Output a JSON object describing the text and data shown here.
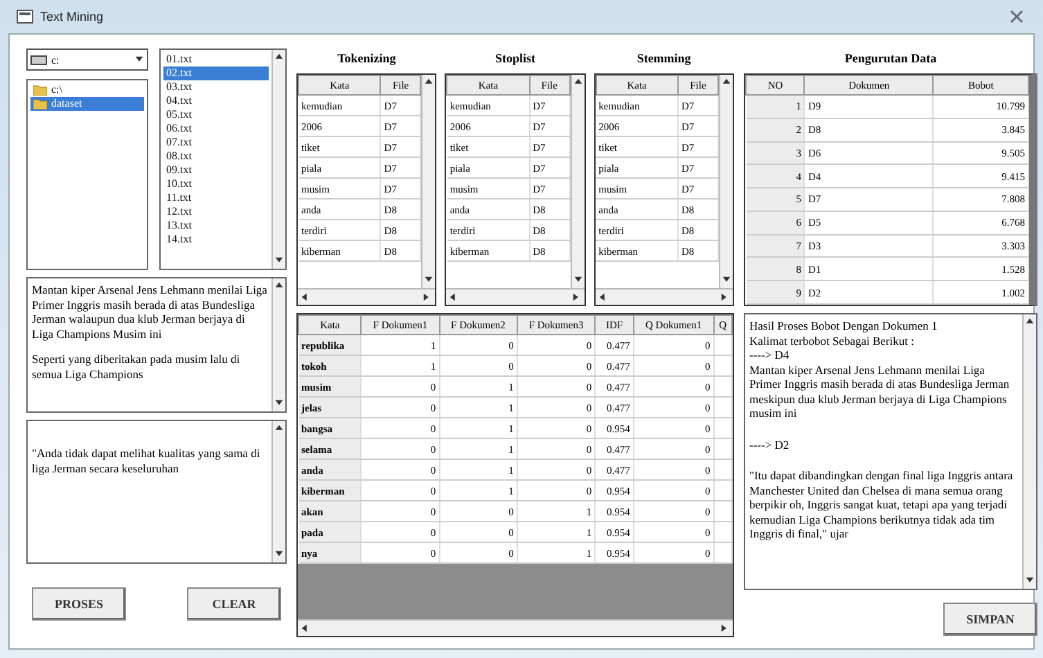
{
  "window": {
    "title": "Text Mining"
  },
  "browser": {
    "drive": "c:",
    "folders": [
      {
        "name": "c:\\",
        "selected": false
      },
      {
        "name": "dataset",
        "selected": true
      }
    ],
    "files": [
      {
        "name": "01.txt",
        "selected": false
      },
      {
        "name": "02.txt",
        "selected": true
      },
      {
        "name": "03.txt",
        "selected": false
      },
      {
        "name": "04.txt",
        "selected": false
      },
      {
        "name": "05.txt",
        "selected": false
      },
      {
        "name": "06.txt",
        "selected": false
      },
      {
        "name": "07.txt",
        "selected": false
      },
      {
        "name": "08.txt",
        "selected": false
      },
      {
        "name": "09.txt",
        "selected": false
      },
      {
        "name": "10.txt",
        "selected": false
      },
      {
        "name": "11.txt",
        "selected": false
      },
      {
        "name": "12.txt",
        "selected": false
      },
      {
        "name": "13.txt",
        "selected": false
      },
      {
        "name": "14.txt",
        "selected": false
      }
    ]
  },
  "input_text": {
    "paragraphs": [
      "Mantan kiper Arsenal Jens Lehmann menilai Liga Primer Inggris masih berada di atas Bundesliga Jerman walaupun dua klub Jerman berjaya di Liga Champions Musim ini",
      "Seperti yang diberitakan pada musim lalu di semua Liga Champions"
    ]
  },
  "query_text": {
    "paragraphs": [
      "\"Anda tidak dapat melihat kualitas yang sama di liga Jerman secara keseluruhan"
    ]
  },
  "term_grids": [
    {
      "title": "Tokenizing",
      "columns": [
        "Kata",
        "File"
      ],
      "rows": [
        [
          "kemudian",
          "D7"
        ],
        [
          "2006",
          "D7"
        ],
        [
          "tiket",
          "D7"
        ],
        [
          "piala",
          "D7"
        ],
        [
          "musim",
          "D7"
        ],
        [
          "anda",
          "D8"
        ],
        [
          "terdiri",
          "D8"
        ],
        [
          "kiberman",
          "D8"
        ]
      ]
    },
    {
      "title": "Stoplist",
      "columns": [
        "Kata",
        "File"
      ],
      "rows": [
        [
          "kemudian",
          "D7"
        ],
        [
          "2006",
          "D7"
        ],
        [
          "tiket",
          "D7"
        ],
        [
          "piala",
          "D7"
        ],
        [
          "musim",
          "D7"
        ],
        [
          "anda",
          "D8"
        ],
        [
          "terdiri",
          "D8"
        ],
        [
          "kiberman",
          "D8"
        ]
      ]
    },
    {
      "title": "Stemming",
      "columns": [
        "Kata",
        "File"
      ],
      "rows": [
        [
          "kemudian",
          "D7"
        ],
        [
          "2006",
          "D7"
        ],
        [
          "tiket",
          "D7"
        ],
        [
          "piala",
          "D7"
        ],
        [
          "musim",
          "D7"
        ],
        [
          "anda",
          "D8"
        ],
        [
          "terdiri",
          "D8"
        ],
        [
          "kiberman",
          "D8"
        ]
      ]
    }
  ],
  "weight_table": {
    "columns": [
      "Kata",
      "F Dokumen1",
      "F Dokumen2",
      "F Dokumen3",
      "IDF",
      "Q Dokumen1",
      "Q"
    ],
    "rows": [
      [
        "republika",
        "1",
        "0",
        "0",
        "0.477",
        "0"
      ],
      [
        "tokoh",
        "1",
        "0",
        "0",
        "0.477",
        "0"
      ],
      [
        "musim",
        "0",
        "1",
        "0",
        "0.477",
        "0"
      ],
      [
        "jelas",
        "0",
        "1",
        "0",
        "0.477",
        "0"
      ],
      [
        "bangsa",
        "0",
        "1",
        "0",
        "0.954",
        "0"
      ],
      [
        "selama",
        "0",
        "1",
        "0",
        "0.477",
        "0"
      ],
      [
        "anda",
        "0",
        "1",
        "0",
        "0.477",
        "0"
      ],
      [
        "kiberman",
        "0",
        "1",
        "0",
        "0.954",
        "0"
      ],
      [
        "akan",
        "0",
        "0",
        "1",
        "0.954",
        "0"
      ],
      [
        "pada",
        "0",
        "0",
        "1",
        "0.954",
        "0"
      ],
      [
        "nya",
        "0",
        "0",
        "1",
        "0.954",
        "0"
      ]
    ]
  },
  "ranking": {
    "title": "Pengurutan Data",
    "columns": [
      "NO",
      "Dokumen",
      "Bobot"
    ],
    "rows": [
      [
        "1",
        "D9",
        "10.799"
      ],
      [
        "2",
        "D8",
        "3.845"
      ],
      [
        "3",
        "D6",
        "9.505"
      ],
      [
        "4",
        "D4",
        "9.415"
      ],
      [
        "5",
        "D7",
        "7.808"
      ],
      [
        "6",
        "D5",
        "6.768"
      ],
      [
        "7",
        "D3",
        "3.303"
      ],
      [
        "8",
        "D1",
        "1.528"
      ],
      [
        "9",
        "D2",
        "1.002"
      ]
    ]
  },
  "result_text": {
    "lines": [
      "Hasil Proses Bobot Dengan Dokumen 1",
      "Kalimat terbobot Sebagai Berikut :",
      "----> D4",
      "Mantan kiper Arsenal Jens Lehmann menilai Liga Primer Inggris masih berada di atas Bundesliga Jerman meskipun dua klub Jerman berjaya di Liga Champions musim ini",
      "----> D2",
      "\"Itu dapat dibandingkan dengan final liga Inggris antara Manchester United dan Chelsea di mana semua orang berpikir oh, Inggris sangat kuat, tetapi apa yang terjadi kemudian Liga Champions berikutnya tidak ada tim Inggris di final,\" ujar"
    ]
  },
  "buttons": {
    "process": "PROSES",
    "clear": "CLEAR",
    "save": "SIMPAN"
  }
}
